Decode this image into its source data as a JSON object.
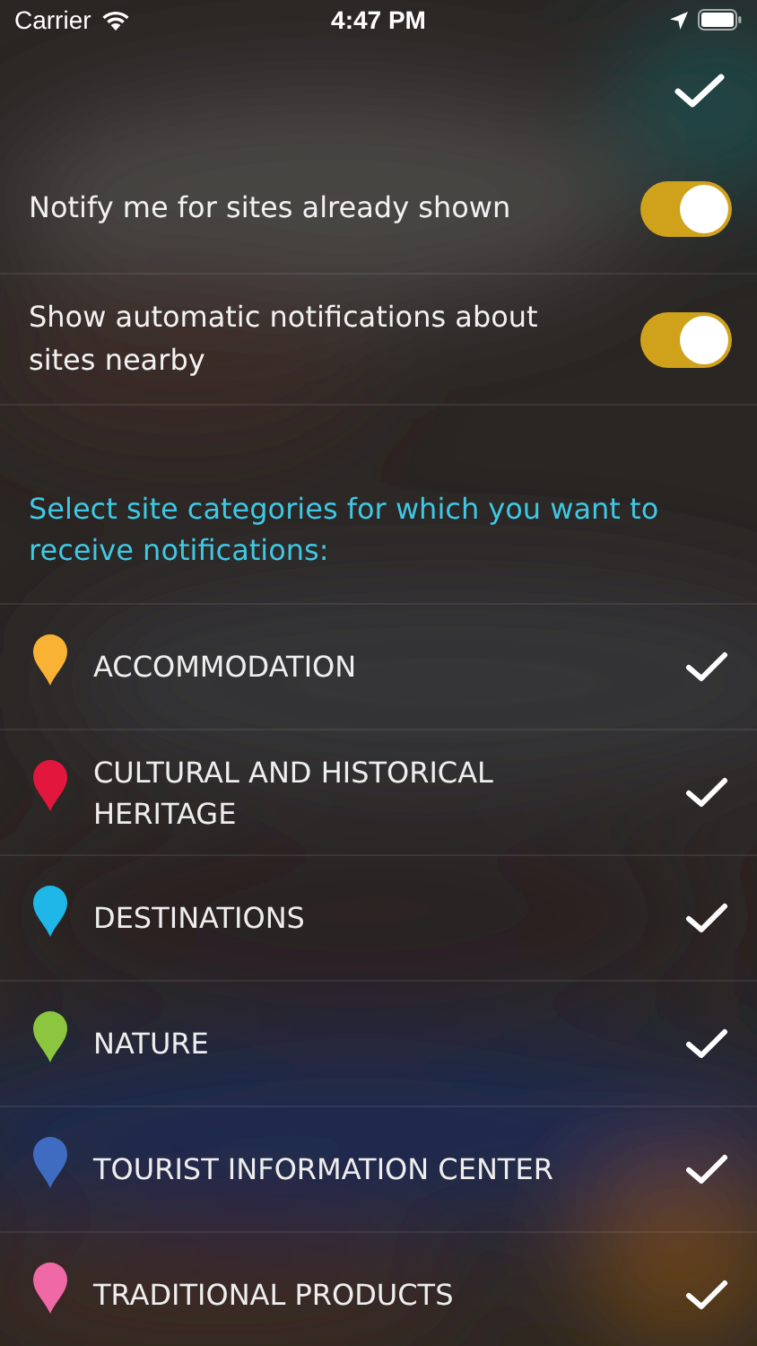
{
  "status_bar": {
    "carrier": "Carrier",
    "time": "4:47 PM"
  },
  "toggles": [
    {
      "label": "Notify me for sites already shown",
      "on": true
    },
    {
      "label": "Show automatic notifications about sites nearby",
      "on": true
    }
  ],
  "section_heading": "Select site categories for which you want to receive notifications:",
  "categories": [
    {
      "label": "ACCOMMODATION",
      "color": "#f9b233",
      "checked": true
    },
    {
      "label": "CULTURAL AND HISTORICAL HERITAGE",
      "color": "#e3173e",
      "checked": true
    },
    {
      "label": "DESTINATIONS",
      "color": "#1fb6e8",
      "checked": true
    },
    {
      "label": "NATURE",
      "color": "#8cc63f",
      "checked": true
    },
    {
      "label": "TOURIST INFORMATION CENTER",
      "color": "#3f6cc0",
      "checked": true
    },
    {
      "label": "TRADITIONAL PRODUCTS",
      "color": "#ef69a6",
      "checked": true
    }
  ]
}
